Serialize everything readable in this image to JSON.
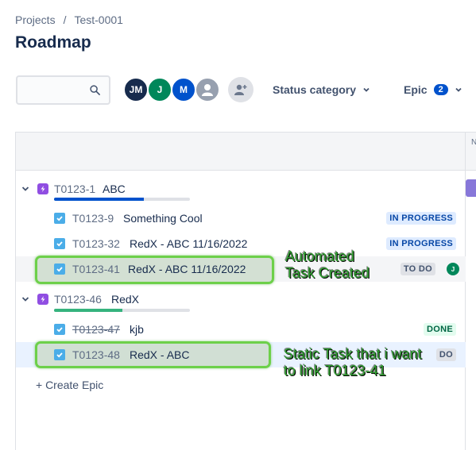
{
  "breadcrumb": {
    "project": "Projects",
    "separator": "/",
    "board": "Test-0001"
  },
  "page": {
    "title": "Roadmap"
  },
  "toolbar": {
    "search_placeholder": "",
    "avatars": [
      {
        "initials": "JM",
        "color": "#172b4d"
      },
      {
        "initials": "J",
        "color": "#00875a"
      },
      {
        "initials": "M",
        "color": "#0052cc"
      },
      {
        "initials": "",
        "color": "#97a0af",
        "icon": "person-icon"
      }
    ],
    "status_filter": "Status category",
    "epic_filter": "Epic",
    "epic_count": "2"
  },
  "timeline": {
    "month_label": "N"
  },
  "epics": [
    {
      "key": "T0123-1",
      "summary": "ABC",
      "progress": 0.66,
      "progress_color": "#0052cc",
      "issues": [
        {
          "key": "T0123-9",
          "summary": "Something Cool",
          "status": "IN PROGRESS"
        },
        {
          "key": "T0123-32",
          "summary": "RedX - ABC 11/16/2022",
          "status": "IN PROGRESS"
        },
        {
          "key": "T0123-41",
          "summary": "RedX - ABC 11/16/2022",
          "status": "TO DO",
          "assignee": "J"
        }
      ]
    },
    {
      "key": "T0123-46",
      "summary": "RedX",
      "progress": 0.5,
      "progress_color": "#36b37e",
      "issues": [
        {
          "key": "T0123-47",
          "summary": "kjb",
          "status": "DONE"
        },
        {
          "key": "T0123-48",
          "summary": "RedX - ABC",
          "status": "DO"
        }
      ]
    }
  ],
  "create_epic": "+ Create Epic",
  "annotations": {
    "note1_line1": "Automated",
    "note1_line2": "Task Created",
    "note2_line1": "Static Task that i want",
    "note2_line2": "to link T0123-41"
  },
  "colors": {
    "callout_border": "#6dd04a",
    "note_text": "#2f9e2f",
    "epic_purple": "#904ee2",
    "task_blue": "#4bade8"
  }
}
